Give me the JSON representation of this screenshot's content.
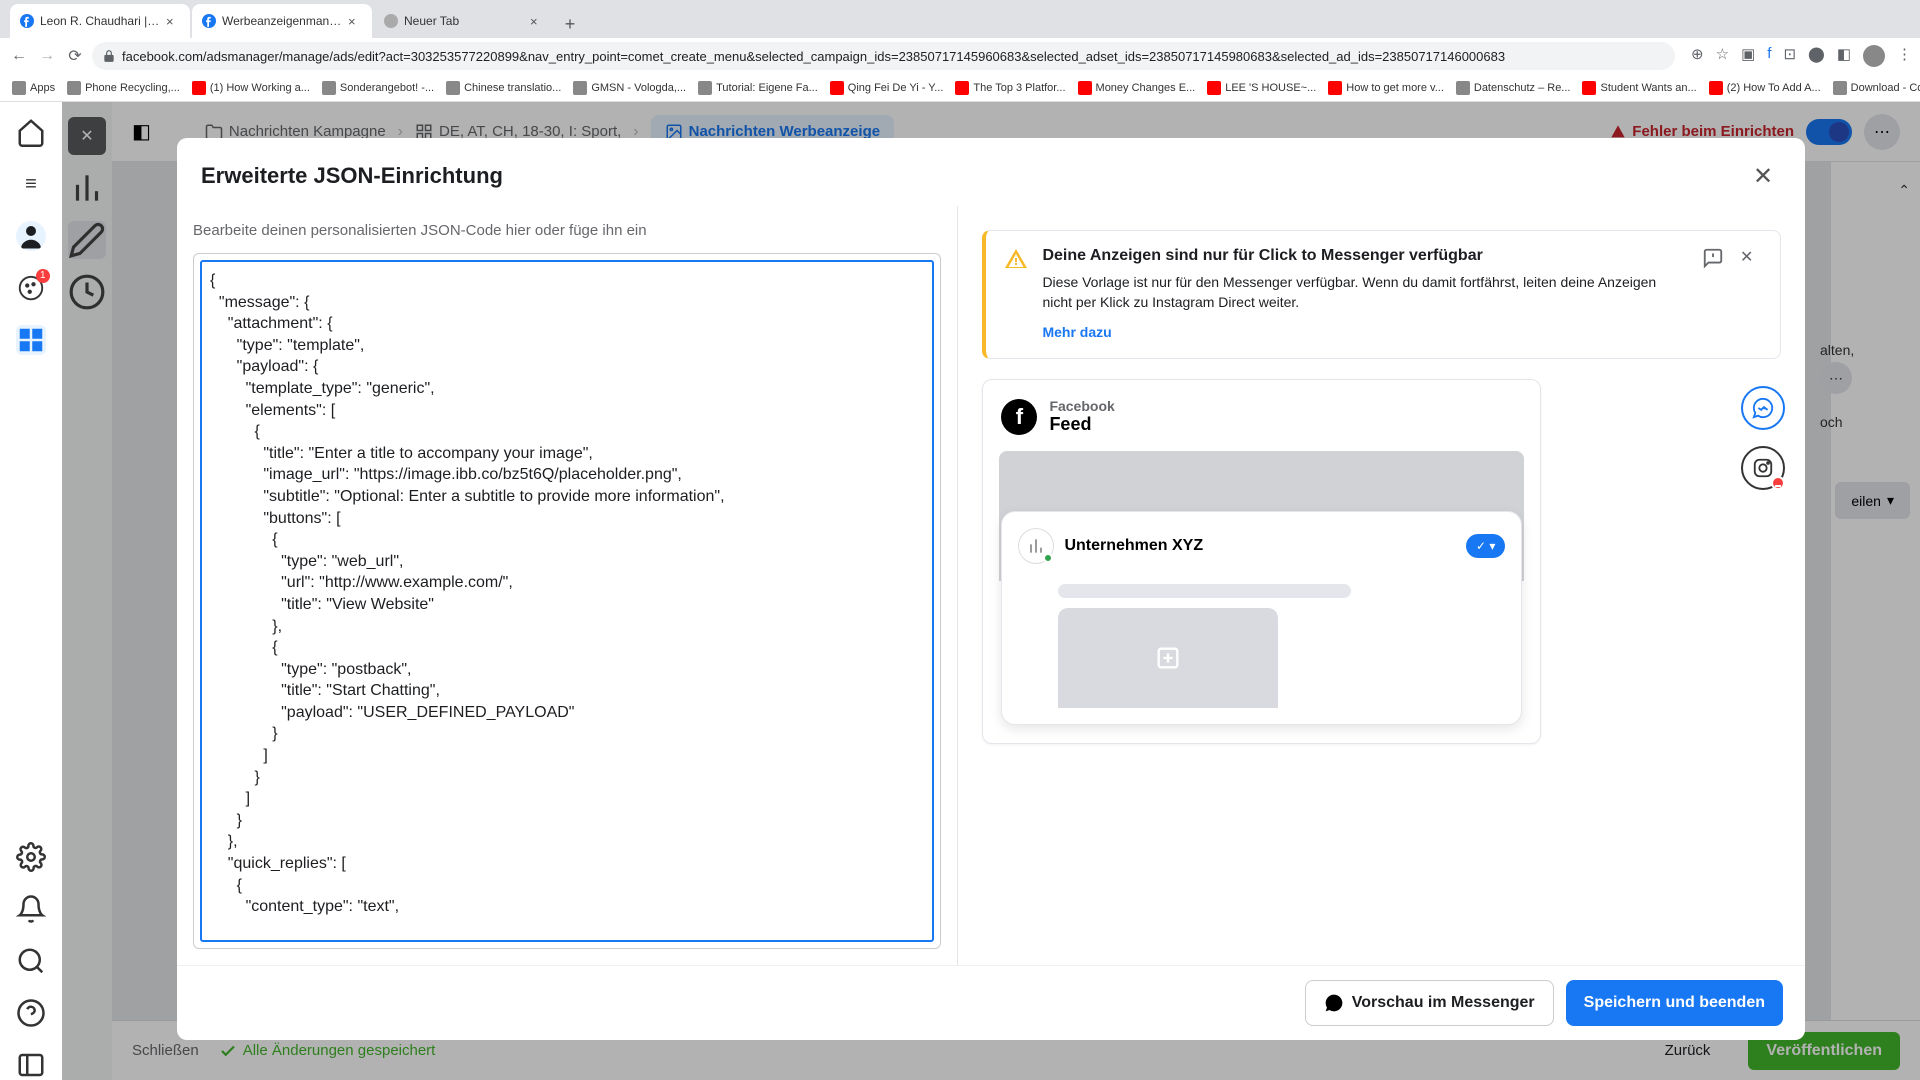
{
  "browser": {
    "tabs": [
      {
        "title": "Leon R. Chaudhari | Facebook"
      },
      {
        "title": "Werbeanzeigenmanager - We"
      },
      {
        "title": "Neuer Tab"
      }
    ],
    "url": "facebook.com/adsmanager/manage/ads/edit?act=303253577220899&nav_entry_point=comet_create_menu&selected_campaign_ids=23850717145960683&selected_adset_ids=23850717145980683&selected_ad_ids=23850717146000683",
    "bookmarks": [
      "Apps",
      "Phone Recycling,...",
      "(1) How Working a...",
      "Sonderangebot! -...",
      "Chinese translatio...",
      "GMSN - Vologda,...",
      "Tutorial: Eigene Fa...",
      "Qing Fei De Yi - Y...",
      "The Top 3 Platfor...",
      "Money Changes E...",
      "LEE 'S HOUSE~...",
      "How to get more v...",
      "Datenschutz – Re...",
      "Student Wants an...",
      "(2) How To Add A...",
      "Download - Cooki..."
    ]
  },
  "breadcrumb": {
    "campaign": "Nachrichten Kampagne",
    "adset": "DE, AT, CH, 18-30, I: Sport,",
    "ad": "Nachrichten Werbeanzeige",
    "error": "Fehler beim Einrichten"
  },
  "modal": {
    "title": "Erweiterte JSON-Einrichtung",
    "edit_label": "Bearbeite deinen personalisierten JSON-Code hier oder füge ihn ein",
    "code": "{\n  \"message\": {\n    \"attachment\": {\n      \"type\": \"template\",\n      \"payload\": {\n        \"template_type\": \"generic\",\n        \"elements\": [\n          {\n            \"title\": \"Enter a title to accompany your image\",\n            \"image_url\": \"https://image.ibb.co/bz5t6Q/placeholder.png\",\n            \"subtitle\": \"Optional: Enter a subtitle to provide more information\",\n            \"buttons\": [\n              {\n                \"type\": \"web_url\",\n                \"url\": \"http://www.example.com/\",\n                \"title\": \"View Website\"\n              },\n              {\n                \"type\": \"postback\",\n                \"title\": \"Start Chatting\",\n                \"payload\": \"USER_DEFINED_PAYLOAD\"\n              }\n            ]\n          }\n        ]\n      }\n    },\n    \"quick_replies\": [\n      {\n        \"content_type\": \"text\",",
    "alert": {
      "title": "Deine Anzeigen sind nur für Click to Messenger verfügbar",
      "text": "Diese Vorlage ist nur für den Messenger verfügbar. Wenn du damit fortfährst, leiten deine Anzeigen nicht per Klick zu Instagram Direct weiter.",
      "link": "Mehr dazu"
    },
    "preview": {
      "brand": "Facebook",
      "feed": "Feed",
      "company": "Unternehmen XYZ"
    },
    "foot": {
      "preview": "Vorschau im Messenger",
      "save": "Speichern und beenden"
    }
  },
  "bottom": {
    "close": "Schließen",
    "saved": "Alle Änderungen gespeichert",
    "back": "Zurück",
    "publish": "Veröffentlichen"
  },
  "rail_badge": "1",
  "peek": {
    "text1": "alten,",
    "text2": "och",
    "share": "eilen"
  }
}
